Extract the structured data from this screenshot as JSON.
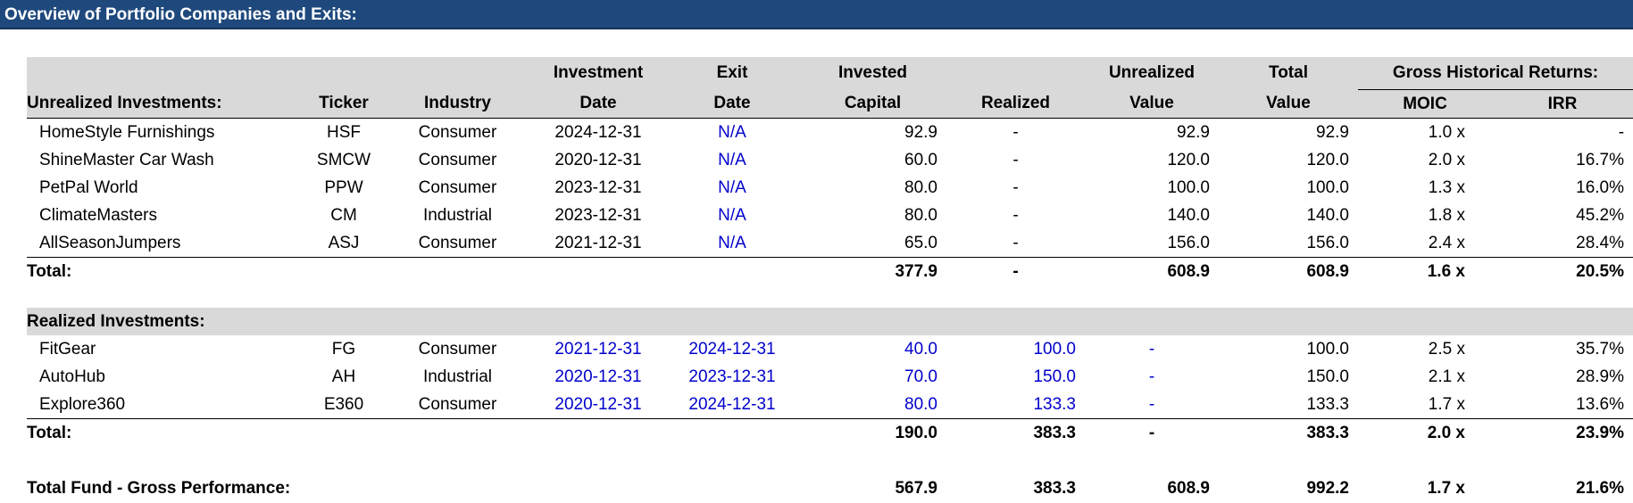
{
  "title": "Overview of Portfolio Companies and Exits:",
  "headers": {
    "row1": [
      "",
      "",
      "",
      "Investment",
      "Exit",
      "Invested",
      "",
      "Unrealized",
      "Total",
      "Gross Historical Returns:"
    ],
    "row2": [
      "Unrealized Investments:",
      "Ticker",
      "Industry",
      "Date",
      "Date",
      "Capital",
      "Realized",
      "Value",
      "Value",
      "MOIC",
      "IRR"
    ]
  },
  "unrealized": [
    {
      "name": "HomeStyle Furnishings",
      "ticker": "HSF",
      "industry": "Consumer",
      "inv_date": "2024-12-31",
      "exit_date": "N/A",
      "capital": "92.9",
      "realized": "-",
      "unrealized": "92.9",
      "total": "92.9",
      "moic": "1.0 x",
      "irr": "-"
    },
    {
      "name": "ShineMaster Car Wash",
      "ticker": "SMCW",
      "industry": "Consumer",
      "inv_date": "2020-12-31",
      "exit_date": "N/A",
      "capital": "60.0",
      "realized": "-",
      "unrealized": "120.0",
      "total": "120.0",
      "moic": "2.0 x",
      "irr": "16.7%"
    },
    {
      "name": "PetPal World",
      "ticker": "PPW",
      "industry": "Consumer",
      "inv_date": "2023-12-31",
      "exit_date": "N/A",
      "capital": "80.0",
      "realized": "-",
      "unrealized": "100.0",
      "total": "100.0",
      "moic": "1.3 x",
      "irr": "16.0%"
    },
    {
      "name": "ClimateMasters",
      "ticker": "CM",
      "industry": "Industrial",
      "inv_date": "2023-12-31",
      "exit_date": "N/A",
      "capital": "80.0",
      "realized": "-",
      "unrealized": "140.0",
      "total": "140.0",
      "moic": "1.8 x",
      "irr": "45.2%"
    },
    {
      "name": "AllSeasonJumpers",
      "ticker": "ASJ",
      "industry": "Consumer",
      "inv_date": "2021-12-31",
      "exit_date": "N/A",
      "capital": "65.0",
      "realized": "-",
      "unrealized": "156.0",
      "total": "156.0",
      "moic": "2.4 x",
      "irr": "28.4%"
    }
  ],
  "unrealized_total": {
    "label": "Total:",
    "capital": "377.9",
    "realized": "-",
    "unrealized": "608.9",
    "total": "608.9",
    "moic": "1.6 x",
    "irr": "20.5%"
  },
  "realized_header": "Realized Investments:",
  "realized": [
    {
      "name": "FitGear",
      "ticker": "FG",
      "industry": "Consumer",
      "inv_date": "2021-12-31",
      "exit_date": "2024-12-31",
      "capital": "40.0",
      "realized": "100.0",
      "unrealized": "-",
      "total": "100.0",
      "moic": "2.5 x",
      "irr": "35.7%"
    },
    {
      "name": "AutoHub",
      "ticker": "AH",
      "industry": "Industrial",
      "inv_date": "2020-12-31",
      "exit_date": "2023-12-31",
      "capital": "70.0",
      "realized": "150.0",
      "unrealized": "-",
      "total": "150.0",
      "moic": "2.1 x",
      "irr": "28.9%"
    },
    {
      "name": "Explore360",
      "ticker": "E360",
      "industry": "Consumer",
      "inv_date": "2020-12-31",
      "exit_date": "2024-12-31",
      "capital": "80.0",
      "realized": "133.3",
      "unrealized": "-",
      "total": "133.3",
      "moic": "1.7 x",
      "irr": "13.6%"
    }
  ],
  "realized_total": {
    "label": "Total:",
    "capital": "190.0",
    "realized": "383.3",
    "unrealized": "-",
    "total": "383.3",
    "moic": "2.0 x",
    "irr": "23.9%"
  },
  "fund_total": {
    "label": "Total Fund - Gross Performance:",
    "capital": "567.9",
    "realized": "383.3",
    "unrealized": "608.9",
    "total": "992.2",
    "moic": "1.7 x",
    "irr": "21.6%"
  },
  "colors": {
    "banner": "#1f497d",
    "header_fill": "#d9d9d9",
    "input_blue": "#0000cc"
  }
}
